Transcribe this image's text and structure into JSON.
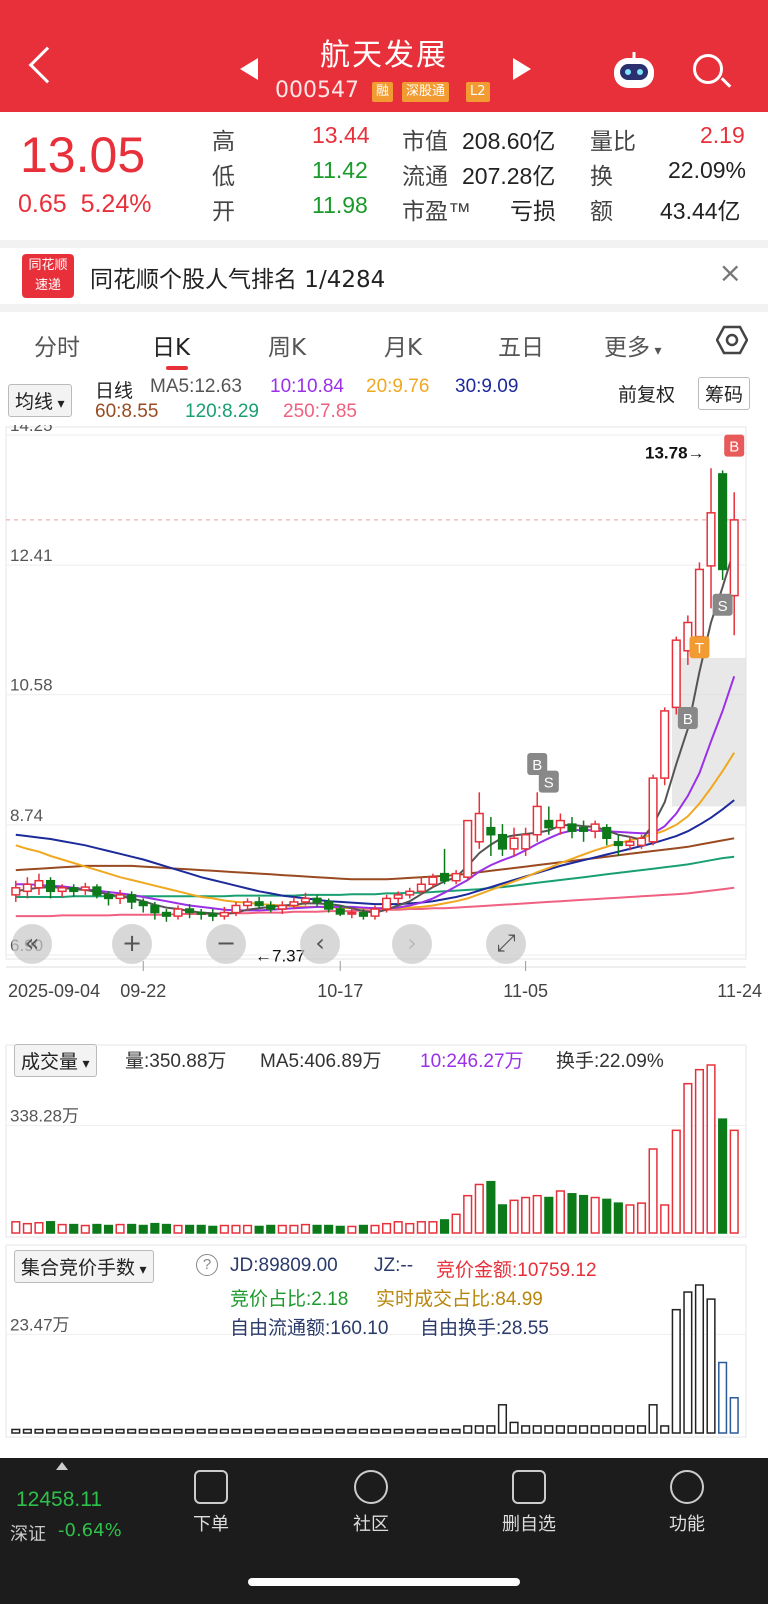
{
  "header": {
    "title": "航天发展",
    "code": "000547",
    "tags": [
      "融",
      "深股通",
      "L2"
    ],
    "bg": "#e8303a"
  },
  "quote": {
    "price": "13.05",
    "change": "0.65",
    "pct": "5.24%",
    "high_label": "高",
    "high": "13.44",
    "low_label": "低",
    "low": "11.42",
    "open_label": "开",
    "open": "11.98",
    "mcap_label": "市值",
    "mcap": "208.60亿",
    "float_label": "流通",
    "float": "207.28亿",
    "pe_label": "市盈™",
    "pe": "亏损",
    "vr_label": "量比",
    "vr": "2.19",
    "turn_label": "换",
    "turn": "22.09%",
    "amt_label": "额",
    "amt": "43.44亿"
  },
  "rank": {
    "logo_top": "同花顺",
    "logo_bottom": "速递",
    "text": "同花顺个股人气排名 1/4284",
    "close": "×"
  },
  "tabs": [
    "分时",
    "日K",
    "周K",
    "月K",
    "五日",
    "更多"
  ],
  "kline_legend": {
    "ma_button": "均线",
    "type": "日线",
    "ma5": "MA5:12.63",
    "ma10": "10:10.84",
    "ma20": "20:9.76",
    "ma30": "30:9.09",
    "ma60": "60:8.55",
    "ma120": "120:8.29",
    "ma250": "250:7.85",
    "adj": "前复权",
    "chip": "筹码"
  },
  "volume_legend": {
    "btn": "成交量",
    "vol": "量:350.88万",
    "ma5": "MA5:406.89万",
    "ma10": "10:246.27万",
    "turn": "换手:22.09%",
    "axis": "338.28万"
  },
  "auction_legend": {
    "btn": "集合竞价手数",
    "help": "?",
    "jd": "JD:89809.00",
    "jz": "JZ:--",
    "amt": "竞价金额:10759.12",
    "ratio": "竞价占比:2.18",
    "real": "实时成交占比:84.99",
    "free": "自由流通额:160.10",
    "free_turn": "自由换手:28.55",
    "axis": "23.47万"
  },
  "chart_data": {
    "type": "candlestick",
    "yticks": [
      "14.25",
      "12.41",
      "10.58",
      "8.74",
      "6.90"
    ],
    "xticks": [
      "2025-09-04",
      "09-22",
      "10-17",
      "11-05",
      "11-24"
    ],
    "max_label": "13.78→",
    "min_label": "←7.37",
    "markers": [
      "B",
      "S",
      "B",
      "S",
      "T",
      "B"
    ],
    "candles": [
      {
        "o": 7.75,
        "c": 7.85,
        "h": 7.95,
        "l": 7.65
      },
      {
        "o": 7.8,
        "c": 7.9,
        "h": 8.0,
        "l": 7.7
      },
      {
        "o": 7.85,
        "c": 7.95,
        "h": 8.05,
        "l": 7.75
      },
      {
        "o": 7.95,
        "c": 7.8,
        "h": 8.0,
        "l": 7.7
      },
      {
        "o": 7.8,
        "c": 7.85,
        "h": 7.9,
        "l": 7.72
      },
      {
        "o": 7.85,
        "c": 7.8,
        "h": 7.9,
        "l": 7.72
      },
      {
        "o": 7.82,
        "c": 7.86,
        "h": 7.92,
        "l": 7.75
      },
      {
        "o": 7.86,
        "c": 7.75,
        "h": 7.9,
        "l": 7.7
      },
      {
        "o": 7.75,
        "c": 7.7,
        "h": 7.8,
        "l": 7.6
      },
      {
        "o": 7.7,
        "c": 7.75,
        "h": 7.82,
        "l": 7.62
      },
      {
        "o": 7.75,
        "c": 7.65,
        "h": 7.8,
        "l": 7.55
      },
      {
        "o": 7.65,
        "c": 7.6,
        "h": 7.7,
        "l": 7.5
      },
      {
        "o": 7.6,
        "c": 7.5,
        "h": 7.65,
        "l": 7.4
      },
      {
        "o": 7.5,
        "c": 7.45,
        "h": 7.55,
        "l": 7.37
      },
      {
        "o": 7.45,
        "c": 7.55,
        "h": 7.6,
        "l": 7.4
      },
      {
        "o": 7.55,
        "c": 7.5,
        "h": 7.62,
        "l": 7.42
      },
      {
        "o": 7.5,
        "c": 7.48,
        "h": 7.55,
        "l": 7.4
      },
      {
        "o": 7.48,
        "c": 7.45,
        "h": 7.55,
        "l": 7.38
      },
      {
        "o": 7.45,
        "c": 7.5,
        "h": 7.58,
        "l": 7.4
      },
      {
        "o": 7.5,
        "c": 7.6,
        "h": 7.65,
        "l": 7.45
      },
      {
        "o": 7.6,
        "c": 7.65,
        "h": 7.7,
        "l": 7.52
      },
      {
        "o": 7.65,
        "c": 7.6,
        "h": 7.72,
        "l": 7.55
      },
      {
        "o": 7.6,
        "c": 7.55,
        "h": 7.66,
        "l": 7.5
      },
      {
        "o": 7.55,
        "c": 7.6,
        "h": 7.66,
        "l": 7.48
      },
      {
        "o": 7.6,
        "c": 7.65,
        "h": 7.72,
        "l": 7.55
      },
      {
        "o": 7.65,
        "c": 7.7,
        "h": 7.78,
        "l": 7.6
      },
      {
        "o": 7.7,
        "c": 7.65,
        "h": 7.75,
        "l": 7.58
      },
      {
        "o": 7.65,
        "c": 7.55,
        "h": 7.7,
        "l": 7.5
      },
      {
        "o": 7.55,
        "c": 7.48,
        "h": 7.6,
        "l": 7.45
      },
      {
        "o": 7.48,
        "c": 7.5,
        "h": 7.56,
        "l": 7.42
      },
      {
        "o": 7.5,
        "c": 7.45,
        "h": 7.55,
        "l": 7.4
      },
      {
        "o": 7.45,
        "c": 7.55,
        "h": 7.6,
        "l": 7.4
      },
      {
        "o": 7.55,
        "c": 7.7,
        "h": 7.75,
        "l": 7.5
      },
      {
        "o": 7.7,
        "c": 7.75,
        "h": 7.8,
        "l": 7.62
      },
      {
        "o": 7.75,
        "c": 7.8,
        "h": 7.85,
        "l": 7.7
      },
      {
        "o": 7.8,
        "c": 7.9,
        "h": 8.0,
        "l": 7.75
      },
      {
        "o": 7.9,
        "c": 8.0,
        "h": 8.05,
        "l": 7.85
      },
      {
        "o": 8.05,
        "c": 7.95,
        "h": 8.4,
        "l": 7.9
      },
      {
        "o": 7.95,
        "c": 8.05,
        "h": 8.1,
        "l": 7.9
      },
      {
        "o": 8.0,
        "c": 8.8,
        "h": 8.8,
        "l": 7.95
      },
      {
        "o": 8.5,
        "c": 8.9,
        "h": 9.2,
        "l": 8.4
      },
      {
        "o": 8.7,
        "c": 8.6,
        "h": 8.85,
        "l": 8.3
      },
      {
        "o": 8.6,
        "c": 8.4,
        "h": 8.75,
        "l": 8.3
      },
      {
        "o": 8.4,
        "c": 8.55,
        "h": 8.7,
        "l": 8.3
      },
      {
        "o": 8.4,
        "c": 8.6,
        "h": 8.7,
        "l": 8.3
      },
      {
        "o": 8.6,
        "c": 9.0,
        "h": 9.2,
        "l": 8.5
      },
      {
        "o": 8.8,
        "c": 8.7,
        "h": 9.0,
        "l": 8.6
      },
      {
        "o": 8.7,
        "c": 8.8,
        "h": 8.9,
        "l": 8.6
      },
      {
        "o": 8.75,
        "c": 8.65,
        "h": 8.85,
        "l": 8.55
      },
      {
        "o": 8.7,
        "c": 8.65,
        "h": 8.8,
        "l": 8.5
      },
      {
        "o": 8.65,
        "c": 8.75,
        "h": 8.8,
        "l": 8.55
      },
      {
        "o": 8.7,
        "c": 8.55,
        "h": 8.75,
        "l": 8.45
      },
      {
        "o": 8.5,
        "c": 8.45,
        "h": 8.6,
        "l": 8.3
      },
      {
        "o": 8.45,
        "c": 8.5,
        "h": 8.58,
        "l": 8.38
      },
      {
        "o": 8.45,
        "c": 8.55,
        "h": 8.6,
        "l": 8.4
      },
      {
        "o": 8.5,
        "c": 9.4,
        "h": 9.45,
        "l": 8.45
      },
      {
        "o": 9.4,
        "c": 10.35,
        "h": 10.4,
        "l": 9.3
      },
      {
        "o": 10.4,
        "c": 11.35,
        "h": 11.4,
        "l": 10.3
      },
      {
        "o": 11.2,
        "c": 11.6,
        "h": 11.7,
        "l": 11.0
      },
      {
        "o": 11.4,
        "c": 12.35,
        "h": 12.45,
        "l": 11.3
      },
      {
        "o": 12.4,
        "c": 13.15,
        "h": 13.78,
        "l": 11.8
      },
      {
        "o": 13.7,
        "c": 12.35,
        "h": 13.75,
        "l": 12.2
      },
      {
        "o": 11.98,
        "c": 13.05,
        "h": 13.44,
        "l": 11.42
      }
    ],
    "ma5": [
      7.8,
      7.83,
      7.85,
      7.86,
      7.85,
      7.83,
      7.82,
      7.79,
      7.76,
      7.73,
      7.7,
      7.66,
      7.61,
      7.57,
      7.55,
      7.52,
      7.5,
      7.49,
      7.48,
      7.5,
      7.54,
      7.56,
      7.58,
      7.6,
      7.61,
      7.63,
      7.63,
      7.62,
      7.6,
      7.56,
      7.52,
      7.5,
      7.54,
      7.6,
      7.66,
      7.76,
      7.86,
      7.94,
      8.0,
      8.16,
      8.34,
      8.46,
      8.56,
      8.59,
      8.61,
      8.63,
      8.66,
      8.73,
      8.74,
      8.72,
      8.71,
      8.66,
      8.6,
      8.57,
      8.53,
      8.74,
      9.06,
      9.6,
      10.1,
      10.9,
      11.6,
      12.1,
      12.63
    ],
    "ma10": [
      7.9,
      7.9,
      7.89,
      7.88,
      7.87,
      7.85,
      7.83,
      7.81,
      7.79,
      7.77,
      7.75,
      7.72,
      7.69,
      7.66,
      7.63,
      7.6,
      7.58,
      7.56,
      7.54,
      7.53,
      7.53,
      7.53,
      7.54,
      7.55,
      7.56,
      7.57,
      7.58,
      7.58,
      7.58,
      7.58,
      7.57,
      7.56,
      7.56,
      7.57,
      7.6,
      7.64,
      7.7,
      7.78,
      7.87,
      7.96,
      8.08,
      8.17,
      8.24,
      8.3,
      8.38,
      8.47,
      8.55,
      8.62,
      8.66,
      8.67,
      8.66,
      8.65,
      8.64,
      8.63,
      8.62,
      8.62,
      8.72,
      8.9,
      9.15,
      9.47,
      9.92,
      10.35,
      10.84
    ],
    "ma20": [
      8.45,
      8.4,
      8.36,
      8.3,
      8.25,
      8.2,
      8.15,
      8.1,
      8.05,
      8.0,
      7.96,
      7.92,
      7.88,
      7.84,
      7.8,
      7.76,
      7.72,
      7.7,
      7.67,
      7.65,
      7.64,
      7.62,
      7.61,
      7.6,
      7.59,
      7.58,
      7.58,
      7.57,
      7.57,
      7.56,
      7.56,
      7.56,
      7.56,
      7.56,
      7.57,
      7.58,
      7.6,
      7.63,
      7.66,
      7.7,
      7.76,
      7.82,
      7.88,
      7.94,
      8.0,
      8.07,
      8.13,
      8.2,
      8.26,
      8.32,
      8.38,
      8.43,
      8.48,
      8.52,
      8.56,
      8.6,
      8.66,
      8.74,
      8.86,
      9.04,
      9.26,
      9.5,
      9.76
    ],
    "ma30": [
      8.6,
      8.58,
      8.56,
      8.54,
      8.51,
      8.48,
      8.45,
      8.41,
      8.37,
      8.33,
      8.29,
      8.25,
      8.2,
      8.15,
      8.1,
      8.05,
      8.0,
      7.96,
      7.92,
      7.88,
      7.84,
      7.8,
      7.77,
      7.74,
      7.72,
      7.7,
      7.68,
      7.66,
      7.65,
      7.64,
      7.63,
      7.62,
      7.62,
      7.62,
      7.63,
      7.64,
      7.66,
      7.69,
      7.72,
      7.76,
      7.81,
      7.86,
      7.91,
      7.96,
      8.01,
      8.06,
      8.11,
      8.16,
      8.2,
      8.24,
      8.28,
      8.32,
      8.36,
      8.4,
      8.44,
      8.48,
      8.53,
      8.58,
      8.65,
      8.74,
      8.84,
      8.96,
      9.09
    ],
    "ma60": [
      8.1,
      8.11,
      8.12,
      8.13,
      8.14,
      8.15,
      8.16,
      8.16,
      8.16,
      8.16,
      8.16,
      8.15,
      8.14,
      8.13,
      8.12,
      8.11,
      8.1,
      8.09,
      8.08,
      8.07,
      8.06,
      8.05,
      8.04,
      8.03,
      8.02,
      8.01,
      8.0,
      7.99,
      7.98,
      7.97,
      7.97,
      7.97,
      7.97,
      7.98,
      7.99,
      8.0,
      8.01,
      8.02,
      8.03,
      8.05,
      8.07,
      8.09,
      8.11,
      8.13,
      8.15,
      8.17,
      8.19,
      8.21,
      8.23,
      8.25,
      8.27,
      8.29,
      8.31,
      8.33,
      8.35,
      8.37,
      8.39,
      8.41,
      8.43,
      8.46,
      8.49,
      8.52,
      8.55
    ],
    "ma120": [
      7.72,
      7.72,
      7.72,
      7.72,
      7.72,
      7.73,
      7.73,
      7.73,
      7.73,
      7.73,
      7.73,
      7.73,
      7.73,
      7.73,
      7.73,
      7.73,
      7.73,
      7.73,
      7.73,
      7.74,
      7.74,
      7.74,
      7.74,
      7.74,
      7.74,
      7.75,
      7.75,
      7.75,
      7.75,
      7.76,
      7.76,
      7.76,
      7.77,
      7.77,
      7.78,
      7.78,
      7.79,
      7.8,
      7.81,
      7.82,
      7.83,
      7.85,
      7.86,
      7.88,
      7.9,
      7.92,
      7.94,
      7.96,
      7.98,
      8.0,
      8.02,
      8.04,
      8.06,
      8.08,
      8.1,
      8.12,
      8.14,
      8.16,
      8.18,
      8.21,
      8.24,
      8.27,
      8.29
    ],
    "ma250": [
      7.45,
      7.45,
      7.45,
      7.45,
      7.46,
      7.46,
      7.46,
      7.46,
      7.46,
      7.47,
      7.47,
      7.47,
      7.47,
      7.47,
      7.48,
      7.48,
      7.48,
      7.48,
      7.49,
      7.49,
      7.49,
      7.5,
      7.5,
      7.5,
      7.51,
      7.51,
      7.51,
      7.52,
      7.52,
      7.52,
      7.53,
      7.53,
      7.54,
      7.54,
      7.55,
      7.55,
      7.56,
      7.56,
      7.57,
      7.58,
      7.59,
      7.6,
      7.61,
      7.62,
      7.63,
      7.64,
      7.65,
      7.66,
      7.67,
      7.68,
      7.69,
      7.7,
      7.71,
      7.72,
      7.73,
      7.74,
      7.75,
      7.76,
      7.77,
      7.79,
      7.81,
      7.83,
      7.85
    ],
    "volume": [
      12,
      10,
      11,
      12,
      9,
      9,
      8,
      9,
      8,
      9,
      9,
      8,
      10,
      9,
      8,
      8,
      8,
      7,
      8,
      8,
      8,
      7,
      8,
      8,
      8,
      9,
      8,
      8,
      7,
      7,
      8,
      8,
      10,
      12,
      10,
      12,
      12,
      14,
      20,
      40,
      52,
      55,
      30,
      35,
      38,
      40,
      38,
      45,
      42,
      40,
      38,
      36,
      32,
      30,
      32,
      90,
      30,
      110,
      160,
      175,
      180,
      122,
      110
    ],
    "auction": [
      1,
      1,
      1,
      1,
      1,
      1,
      1,
      1,
      1,
      1,
      1,
      1,
      1,
      1,
      1,
      1,
      1,
      1,
      1,
      1,
      1,
      1,
      1,
      1,
      1,
      1,
      1,
      1,
      1,
      1,
      1,
      1,
      1,
      1,
      1,
      1,
      1,
      1,
      1,
      2,
      2,
      2,
      8,
      3,
      2,
      2,
      2,
      2,
      2,
      2,
      2,
      2,
      2,
      2,
      2,
      8,
      2,
      35,
      40,
      42,
      38,
      20,
      10
    ]
  },
  "zoom_controls": [
    "«",
    "+",
    "−",
    "‹",
    "›",
    "⤢"
  ],
  "nav": {
    "index_value": "12458.11",
    "index_name": "深证",
    "index_pct": "-0.64%",
    "items": [
      "下单",
      "社区",
      "删自选",
      "功能"
    ]
  }
}
